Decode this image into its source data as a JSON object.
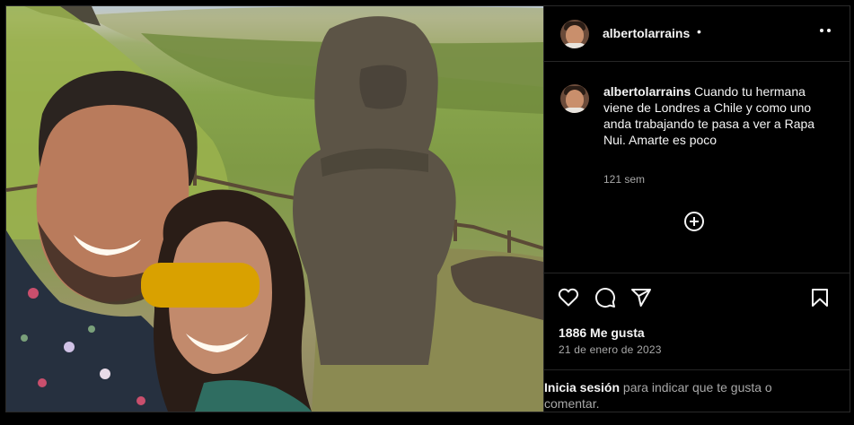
{
  "post": {
    "username": "albertolarrains",
    "header_separator": "•",
    "caption_username": "albertolarrains",
    "caption_text": "Cuando tu hermana viene de Londres a Chile y como uno anda trabajando te pasa a ver a Rapa Nui. Amarte es poco",
    "time_ago": "121 sem",
    "likes": "1886 Me gusta",
    "date": "21 de enero de 2023"
  },
  "login": {
    "link": "Inicia sesión",
    "rest": " para indicar que te gusta o comentar."
  },
  "icons": {
    "more": "more-horizontal-icon",
    "add_comment": "plus-circle-icon",
    "like": "heart-icon",
    "comment": "comment-bubble-icon",
    "share": "paper-plane-icon",
    "save": "bookmark-icon"
  },
  "colors": {
    "background": "#000000",
    "text": "#f5f5f5",
    "muted": "#a8a8a8",
    "divider": "#262626",
    "redaction": "#d9a100"
  }
}
